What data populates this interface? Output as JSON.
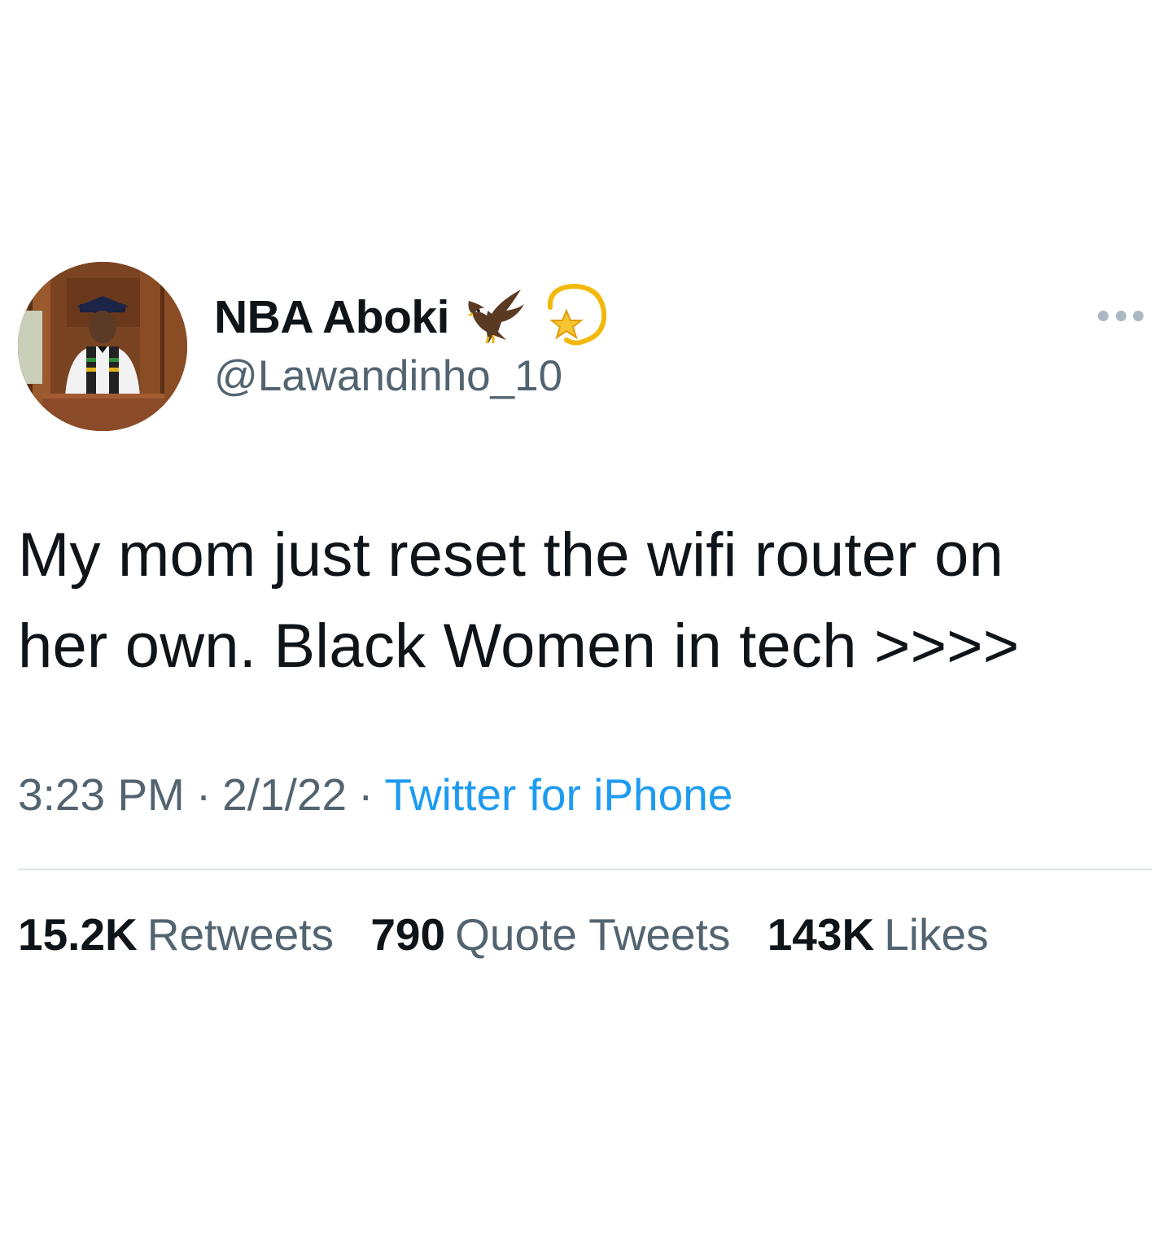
{
  "tweet": {
    "display_name": "NBA Aboki",
    "handle": "@Lawandinho_10",
    "name_emojis": [
      "eagle-emoji",
      "dizzy-star-emoji"
    ],
    "body_line1": "My mom just reset the wifi router on",
    "body_line2": "her own. Black Women in tech >>>>",
    "time": "3:23 PM",
    "date": "2/1/22",
    "separator": "·",
    "source": "Twitter for iPhone",
    "stats": {
      "retweets_count": "15.2K",
      "retweets_label": "Retweets",
      "quotes_count": "790",
      "quotes_label": "Quote Tweets",
      "likes_count": "143K",
      "likes_label": "Likes"
    }
  },
  "colors": {
    "text_primary": "#0f1419",
    "text_secondary": "#536471",
    "link": "#1d9bf0",
    "divider": "#dde3e7"
  }
}
